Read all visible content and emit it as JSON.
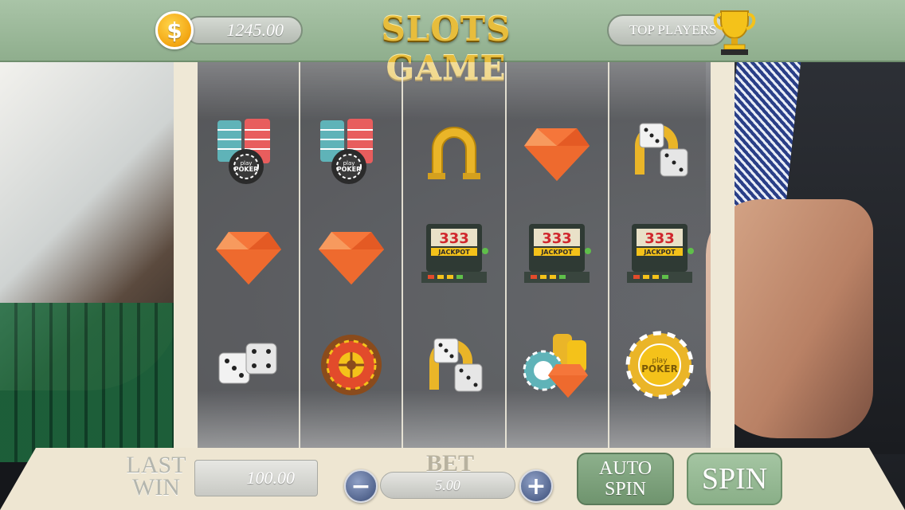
{
  "header": {
    "balance": "1245.00",
    "currency_symbol": "$",
    "title": "SLOTS GAME",
    "top_players_label": "TOP PLAYERS"
  },
  "reels": [
    [
      "partial",
      "poker-chips",
      "diamond",
      "dice",
      "partial"
    ],
    [
      "partial",
      "poker-chips",
      "diamond",
      "roulette",
      "partial"
    ],
    [
      "partial",
      "horseshoe",
      "jackpot-machine",
      "horseshoe-dice",
      "partial"
    ],
    [
      "partial",
      "diamond",
      "jackpot-machine",
      "chips-gems",
      "partial"
    ],
    [
      "partial",
      "horseshoe-dice",
      "jackpot-machine",
      "poker-chip-gold",
      "partial"
    ]
  ],
  "symbol_text": {
    "poker_chip_text": "play\nPOKER",
    "jackpot_digits": "333",
    "jackpot_label": "JACKPOT"
  },
  "footer": {
    "last_win_label_1": "LAST",
    "last_win_label_2": "WIN",
    "last_win_value": "100.00",
    "bet_label": "BET",
    "bet_value": "5.00",
    "minus_label": "−",
    "plus_label": "+",
    "auto_spin_label_1": "AUTO",
    "auto_spin_label_2": "SPIN",
    "spin_label": "SPIN"
  },
  "colors": {
    "bar_green": "#8fae8d",
    "title_gold": "#e7bd3c",
    "button_blue": "#54668f",
    "panel_cream": "#eee6d2"
  }
}
